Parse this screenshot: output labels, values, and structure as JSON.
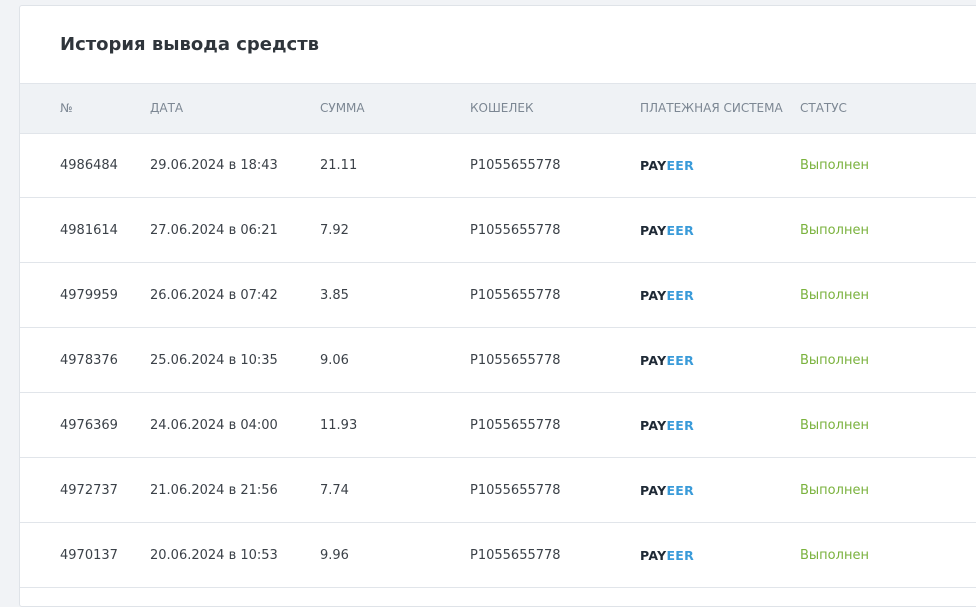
{
  "title": "История вывода средств",
  "columns": {
    "id": "№",
    "date": "ДАТА",
    "amount": "СУММА",
    "wallet": "КОШЕЛЕК",
    "system": "ПЛАТЕЖНАЯ СИСТЕМА",
    "status": "СТАТУС"
  },
  "colors": {
    "status_success": "#7ab23d",
    "payeer_dark": "#1f2a36",
    "payeer_blue": "#3a9bd9"
  },
  "rows": [
    {
      "id": "4986484",
      "date": "29.06.2024 в 18:43",
      "amount": "21.11",
      "wallet": "P1055655778",
      "system": {
        "part1": "PAY",
        "part2": "EER"
      },
      "status": "Выполнен"
    },
    {
      "id": "4981614",
      "date": "27.06.2024 в 06:21",
      "amount": "7.92",
      "wallet": "P1055655778",
      "system": {
        "part1": "PAY",
        "part2": "EER"
      },
      "status": "Выполнен"
    },
    {
      "id": "4979959",
      "date": "26.06.2024 в 07:42",
      "amount": "3.85",
      "wallet": "P1055655778",
      "system": {
        "part1": "PAY",
        "part2": "EER"
      },
      "status": "Выполнен"
    },
    {
      "id": "4978376",
      "date": "25.06.2024 в 10:35",
      "amount": "9.06",
      "wallet": "P1055655778",
      "system": {
        "part1": "PAY",
        "part2": "EER"
      },
      "status": "Выполнен"
    },
    {
      "id": "4976369",
      "date": "24.06.2024 в 04:00",
      "amount": "11.93",
      "wallet": "P1055655778",
      "system": {
        "part1": "PAY",
        "part2": "EER"
      },
      "status": "Выполнен"
    },
    {
      "id": "4972737",
      "date": "21.06.2024 в 21:56",
      "amount": "7.74",
      "wallet": "P1055655778",
      "system": {
        "part1": "PAY",
        "part2": "EER"
      },
      "status": "Выполнен"
    },
    {
      "id": "4970137",
      "date": "20.06.2024 в 10:53",
      "amount": "9.96",
      "wallet": "P1055655778",
      "system": {
        "part1": "PAY",
        "part2": "EER"
      },
      "status": "Выполнен"
    }
  ]
}
